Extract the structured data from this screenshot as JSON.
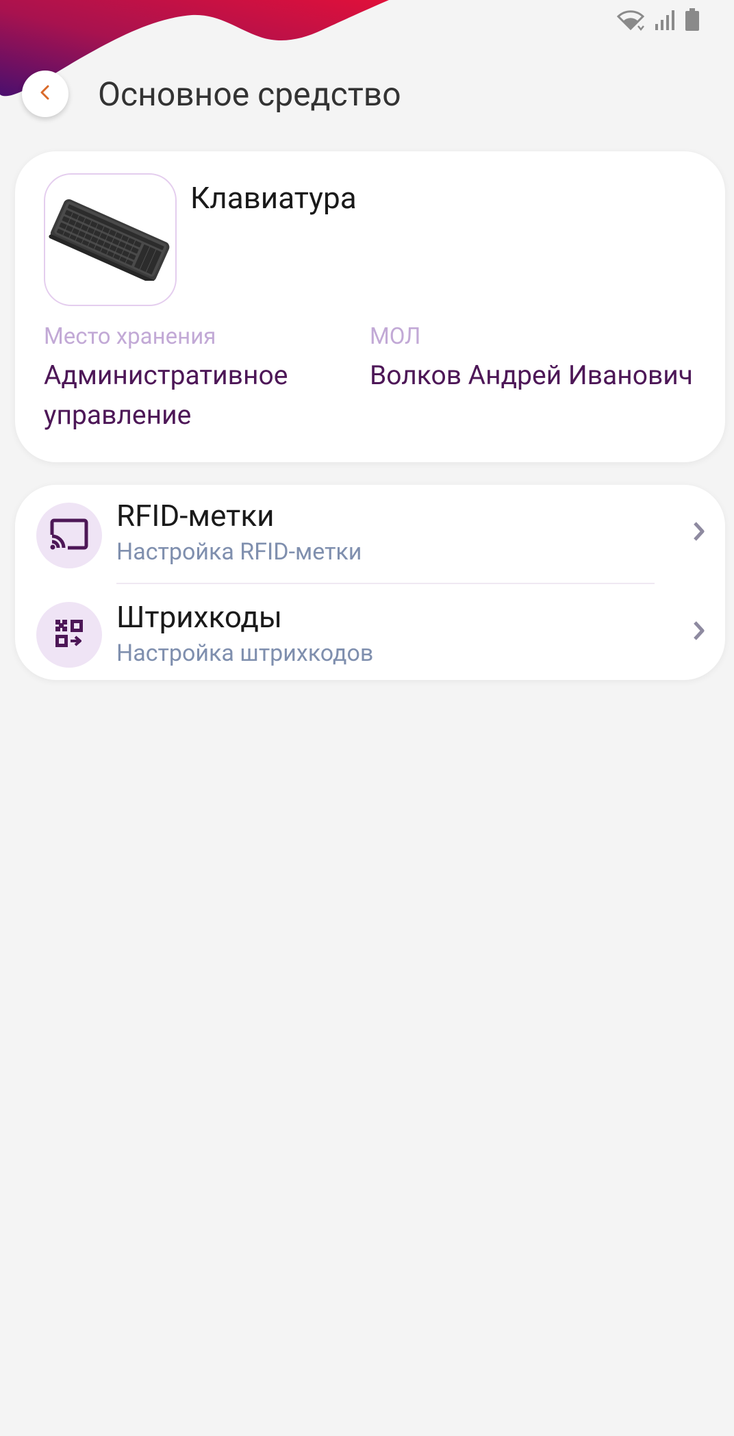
{
  "app_bar": {
    "title": "Основное средство",
    "back_icon": "chevron-left-icon"
  },
  "status_bar": {
    "icons": [
      "wifi-icon",
      "signal-icon",
      "battery-icon"
    ]
  },
  "asset": {
    "name": "Клавиатура",
    "photo": "keyboard-image",
    "storage": {
      "label": "Место хранения",
      "value": "Административное управление"
    },
    "responsible": {
      "label": "МОЛ",
      "value": "Волков Андрей Иванович"
    }
  },
  "menu": {
    "items": [
      {
        "title": "RFID-метки",
        "subtitle": "Настройка RFID-метки",
        "icon": "rfid-cast-icon"
      },
      {
        "title": "Штрихкоды",
        "subtitle": "Настройка штрихкодов",
        "icon": "qr-code-icon"
      }
    ]
  },
  "colors": {
    "accent_dark": "#4d1757",
    "label_light": "#c2a9d6",
    "subtitle": "#7f8fae",
    "icon_bg": "#efe4f5",
    "wave_start": "#4a0f6e",
    "wave_end": "#e0103a",
    "back_arrow": "#d96a2a"
  }
}
